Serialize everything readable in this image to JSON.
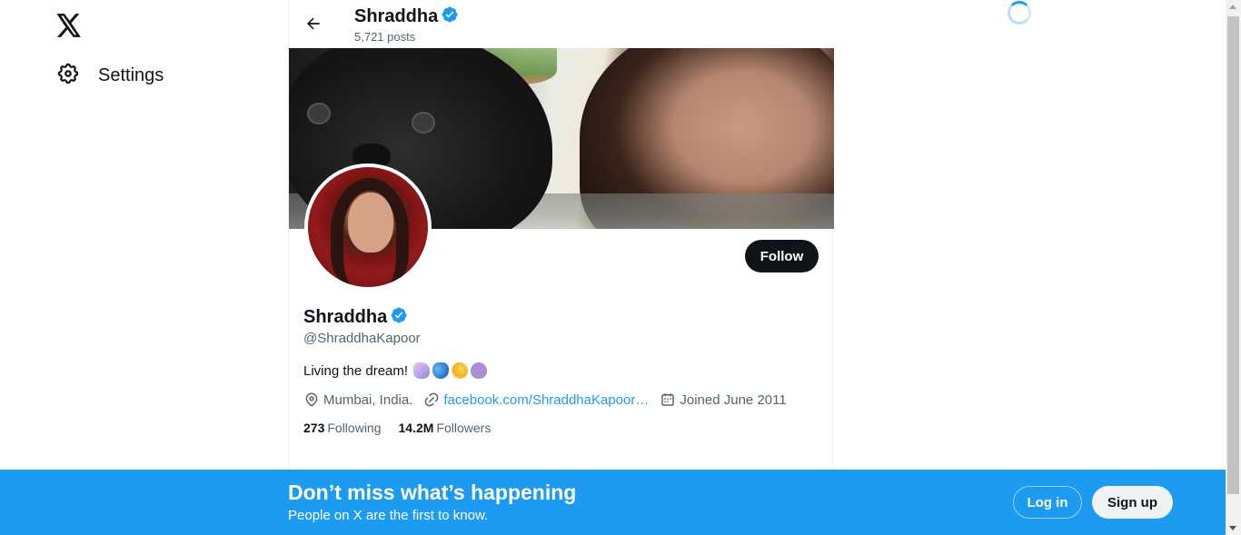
{
  "nav": {
    "settings_label": "Settings"
  },
  "header": {
    "name": "Shraddha",
    "posts": "5,721 posts"
  },
  "profile": {
    "name": "Shraddha",
    "handle": "@ShraddhaKapoor",
    "bio": "Living the dream!",
    "bio_emojis": [
      "unicorn",
      "butterfly",
      "dizzy-star",
      "purple-heart"
    ],
    "location": "Mumbai, India.",
    "link": "facebook.com/ShraddhaKapoor…",
    "joined": "Joined June 2011",
    "following_count": "273",
    "following_label": "Following",
    "followers_count": "14.2M",
    "followers_label": "Followers",
    "follow_button": "Follow",
    "verified": true
  },
  "bottom_banner": {
    "title": "Don’t miss what’s happening",
    "subtitle": "People on X are the first to know.",
    "login_label": "Log in",
    "signup_label": "Sign up"
  },
  "colors": {
    "accent": "#1d9bf0",
    "text": "#0f1419",
    "muted": "#536471"
  }
}
